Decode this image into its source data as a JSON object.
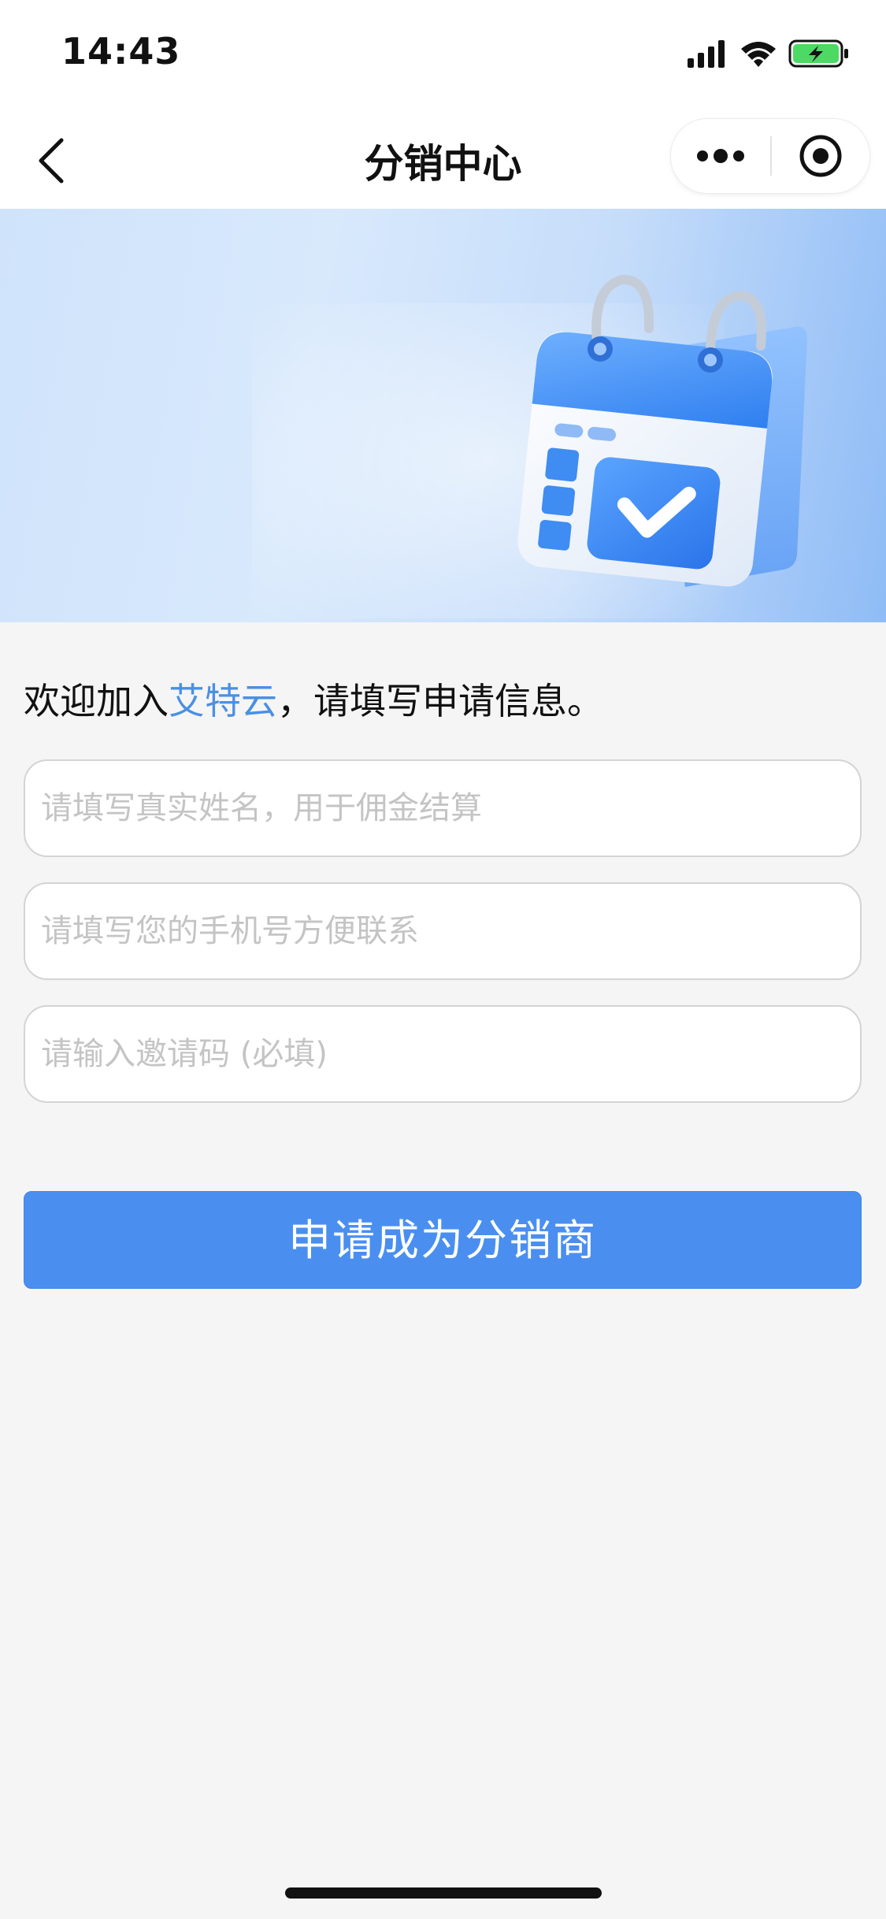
{
  "status_bar": {
    "time": "14:43"
  },
  "nav": {
    "title": "分销中心"
  },
  "form": {
    "welcome_prefix": "欢迎加入",
    "brand_name": "艾特云",
    "welcome_suffix": "，请填写申请信息。",
    "name_placeholder": "请填写真实姓名，用于佣金结算",
    "name_value": "",
    "phone_placeholder": "请填写您的手机号方便联系",
    "phone_value": "",
    "invite_placeholder": "请输入邀请码 (必填)",
    "invite_value": "",
    "submit_label": "申请成为分销商"
  },
  "icons": {
    "back": "chevron-left-icon",
    "more": "more-dots-icon",
    "close": "target-close-icon",
    "signal": "cellular-signal-icon",
    "wifi": "wifi-icon",
    "battery": "battery-charging-icon",
    "banner": "calendar-check-icon"
  },
  "colors": {
    "brand_text": "#4a90e2",
    "button": "#4a8ff0",
    "battery": "#4cd964"
  }
}
